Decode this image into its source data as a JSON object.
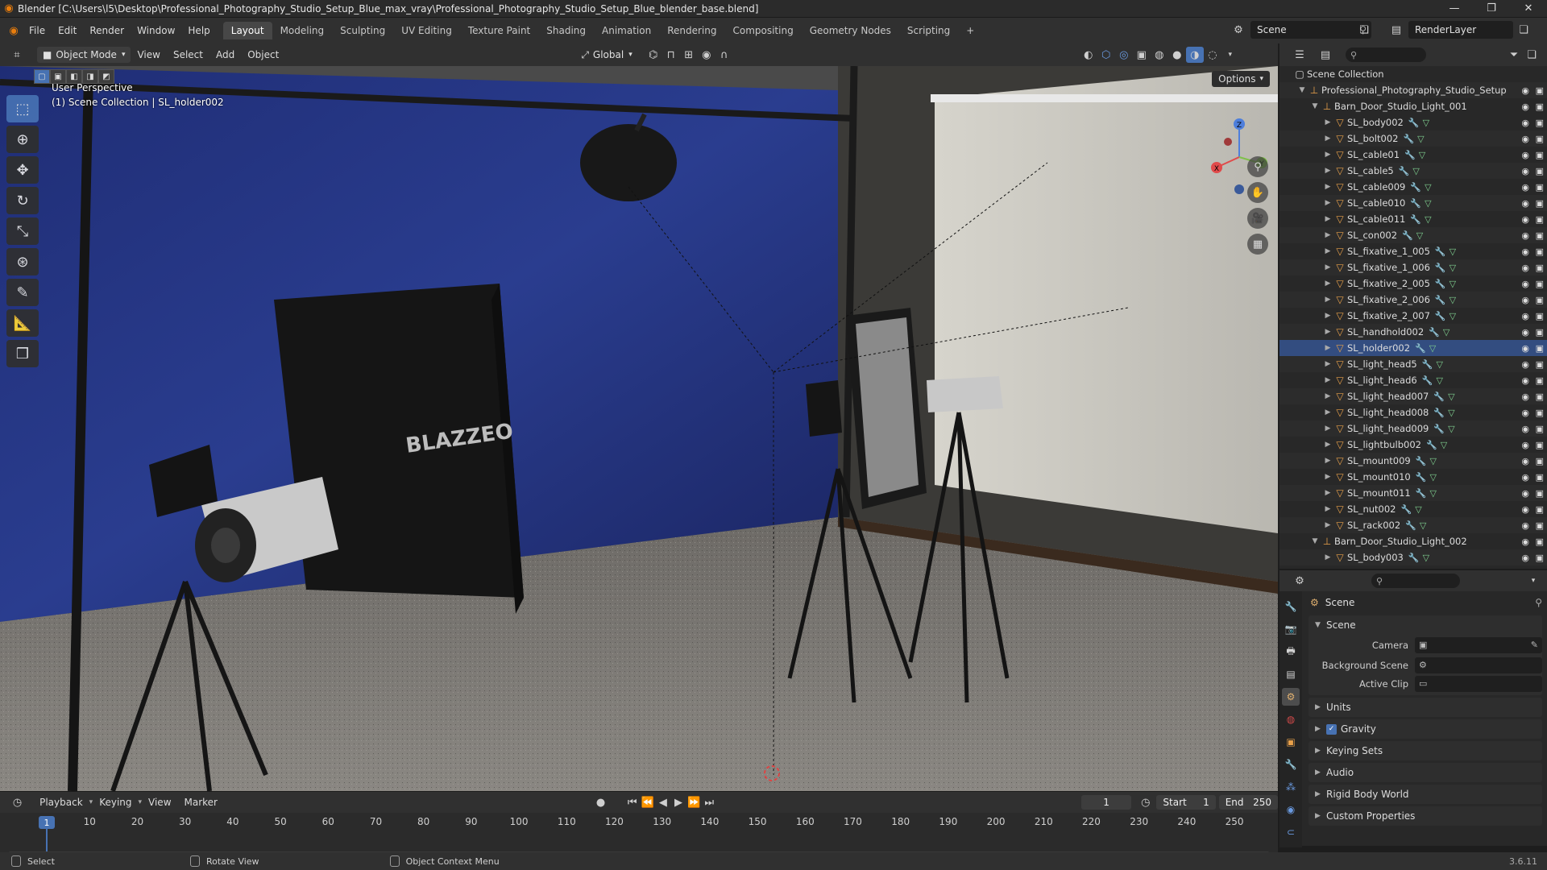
{
  "window": {
    "title": "Blender [C:\\Users\\l5\\Desktop\\Professional_Photography_Studio_Setup_Blue_max_vray\\Professional_Photography_Studio_Setup_Blue_blender_base.blend]",
    "minimize": "—",
    "maximize": "❐",
    "close": "✕"
  },
  "menu": [
    "File",
    "Edit",
    "Render",
    "Window",
    "Help"
  ],
  "workspaces": [
    "Layout",
    "Modeling",
    "Sculpting",
    "UV Editing",
    "Texture Paint",
    "Shading",
    "Animation",
    "Rendering",
    "Compositing",
    "Geometry Nodes",
    "Scripting",
    "+"
  ],
  "active_workspace": "Layout",
  "scene_selector": "Scene",
  "view_layer": "RenderLayer",
  "viewport": {
    "mode": "Object Mode",
    "menus": [
      "View",
      "Select",
      "Add",
      "Object"
    ],
    "transform_orientation": "Global",
    "options": "Options",
    "info_line1": "User Perspective",
    "info_line2": "(1) Scene Collection | SL_holder002",
    "brand_text": "BLAZZEO",
    "gizmo": {
      "z": "Z",
      "x": "X",
      "y": "Y"
    },
    "accent": "#4772b3",
    "wall_color": "#23337a"
  },
  "tools": [
    "select-box",
    "cursor",
    "move",
    "rotate",
    "scale",
    "transform",
    "annotate",
    "measure",
    "add-cube"
  ],
  "outliner": {
    "search_placeholder": "",
    "root": "Scene Collection",
    "collection": "Professional_Photography_Studio_Setup",
    "group1": "Barn_Door_Studio_Light_001",
    "group2": "Barn_Door_Studio_Light_002",
    "items": [
      "SL_body002",
      "SL_bolt002",
      "SL_cable01",
      "SL_cable5",
      "SL_cable009",
      "SL_cable010",
      "SL_cable011",
      "SL_con002",
      "SL_fixative_1_005",
      "SL_fixative_1_006",
      "SL_fixative_2_005",
      "SL_fixative_2_006",
      "SL_fixative_2_007",
      "SL_handhold002",
      "SL_holder002",
      "SL_light_head5",
      "SL_light_head6",
      "SL_light_head007",
      "SL_light_head008",
      "SL_light_head009",
      "SL_lightbulb002",
      "SL_mount009",
      "SL_mount010",
      "SL_mount011",
      "SL_nut002",
      "SL_rack002"
    ],
    "group2_items": [
      "SL_body003"
    ],
    "selected": "SL_holder002"
  },
  "properties": {
    "context": "Scene",
    "panel_scene": "Scene",
    "camera_label": "Camera",
    "background_label": "Background Scene",
    "clip_label": "Active Clip",
    "panels": [
      "Units",
      "Gravity",
      "Keying Sets",
      "Audio",
      "Rigid Body World",
      "Custom Properties"
    ]
  },
  "timeline": {
    "menus": [
      "Playback",
      "Keying",
      "View",
      "Marker"
    ],
    "current_frame": "1",
    "start_label": "Start",
    "start": "1",
    "end_label": "End",
    "end": "250",
    "ticks": [
      "10",
      "20",
      "30",
      "40",
      "50",
      "60",
      "70",
      "80",
      "90",
      "100",
      "110",
      "120",
      "130",
      "140",
      "150",
      "160",
      "170",
      "180",
      "190",
      "200",
      "210",
      "220",
      "230",
      "240",
      "250"
    ],
    "playhead": "1"
  },
  "status": {
    "select": "Select",
    "rotate": "Rotate View",
    "context_menu": "Object Context Menu",
    "version": "3.6.11"
  }
}
